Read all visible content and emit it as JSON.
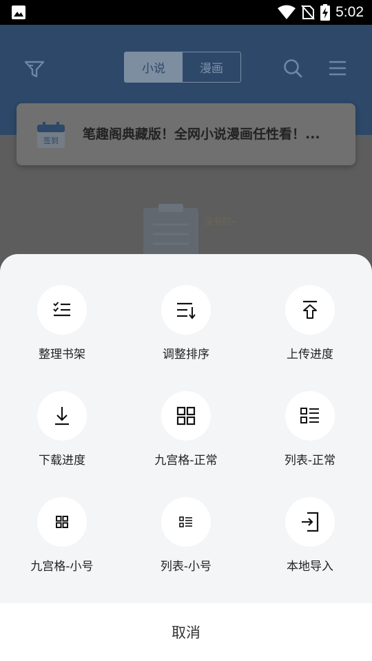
{
  "status_bar": {
    "time": "5:02",
    "icons": [
      "image-icon",
      "wifi-icon",
      "no-sim-icon",
      "battery-charging-icon"
    ]
  },
  "header": {
    "tabs": [
      {
        "label": "小说",
        "active": true
      },
      {
        "label": "漫画",
        "active": false
      }
    ],
    "icons": [
      "filter-icon",
      "search-icon",
      "menu-icon"
    ]
  },
  "notice": {
    "checkin_label": "签到",
    "text": "笔趣阁典藏版！全网小说漫画任性看！..."
  },
  "empty_state": {
    "caption": "没书的~"
  },
  "sheet": {
    "items": [
      {
        "label": "整理书架",
        "icon": "checklist-icon"
      },
      {
        "label": "调整排序",
        "icon": "sort-icon"
      },
      {
        "label": "上传进度",
        "icon": "upload-icon"
      },
      {
        "label": "下载进度",
        "icon": "download-icon"
      },
      {
        "label": "九宫格-正常",
        "icon": "grid-icon"
      },
      {
        "label": "列表-正常",
        "icon": "list-icon"
      },
      {
        "label": "九宫格-小号",
        "icon": "small-grid-icon"
      },
      {
        "label": "列表-小号",
        "icon": "small-list-icon"
      },
      {
        "label": "本地导入",
        "icon": "import-icon"
      }
    ],
    "cancel_label": "取消"
  },
  "colors": {
    "header_dimmed": "#2d4868",
    "sheet_bg": "#f4f5f7",
    "overlay": "#5e5e5e"
  }
}
